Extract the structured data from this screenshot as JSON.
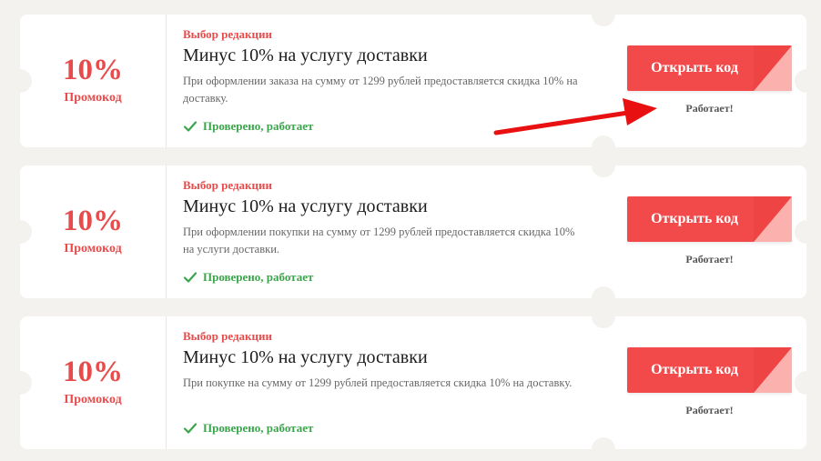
{
  "coupons": [
    {
      "discount": "10%",
      "type": "Промокод",
      "badge": "Выбор редакции",
      "title": "Минус 10% на услугу доставки",
      "description": "При оформлении заказа на сумму от 1299 рублей предоставляется скидка 10% на доставку.",
      "verified": "Проверено, работает",
      "button": "Открыть код",
      "status": "Работает!"
    },
    {
      "discount": "10%",
      "type": "Промокод",
      "badge": "Выбор редакции",
      "title": "Минус 10% на услугу доставки",
      "description": "При оформлении покупки на сумму от 1299 рублей предоставляется скидка 10% на услуги доставки.",
      "verified": "Проверено, работает",
      "button": "Открыть код",
      "status": "Работает!"
    },
    {
      "discount": "10%",
      "type": "Промокод",
      "badge": "Выбор редакции",
      "title": "Минус 10% на услугу доставки",
      "description": "При покупке на сумму от 1299 рублей предоставляется скидка 10% на доставку.",
      "verified": "Проверено, работает",
      "button": "Открыть код",
      "status": "Работает!"
    }
  ],
  "colors": {
    "accent": "#e84b4b",
    "button": "#f24a4a",
    "verified": "#3aa54a",
    "arrow": "#e81010"
  },
  "icons": {
    "verified": "check-icon",
    "pointer": "red-arrow"
  }
}
